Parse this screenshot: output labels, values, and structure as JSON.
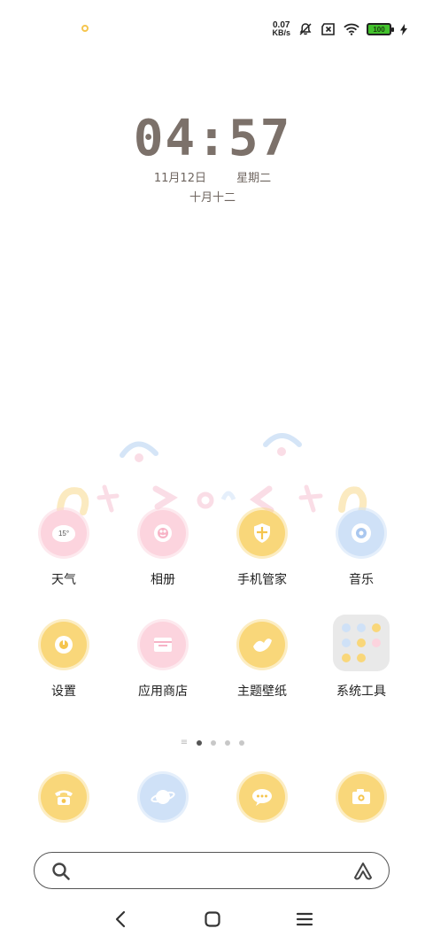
{
  "status_bar": {
    "net_speed_value": "0.07",
    "net_speed_unit": "KB/s",
    "battery_level": "100",
    "icons": [
      "notification-dot-icon",
      "bell-off-icon",
      "sim-off-icon",
      "wifi-icon",
      "battery-icon",
      "charging-icon"
    ]
  },
  "clock": {
    "time": "04:57",
    "date": "11月12日",
    "weekday": "星期二",
    "lunar": "十月十二"
  },
  "apps_row1": [
    {
      "label": "天气",
      "icon": "weather-icon",
      "weather_temp": "15°"
    },
    {
      "label": "相册",
      "icon": "gallery-icon"
    },
    {
      "label": "手机管家",
      "icon": "security-icon"
    },
    {
      "label": "音乐",
      "icon": "music-icon"
    }
  ],
  "apps_row2": [
    {
      "label": "设置",
      "icon": "settings-icon"
    },
    {
      "label": "应用商店",
      "icon": "app-store-icon"
    },
    {
      "label": "主题壁纸",
      "icon": "themes-icon"
    },
    {
      "label": "系统工具",
      "icon": "system-tools-folder-icon"
    }
  ],
  "page_indicator": {
    "pages": 4,
    "active_page": 1
  },
  "dock": [
    {
      "icon": "phone-icon"
    },
    {
      "icon": "browser-icon"
    },
    {
      "icon": "messages-icon"
    },
    {
      "icon": "camera-icon"
    }
  ],
  "search": {
    "placeholder": ""
  },
  "navigation": {
    "buttons": [
      "back-icon",
      "home-icon",
      "recents-icon"
    ]
  },
  "colors": {
    "clock": "#7c716a",
    "icon_yellow": "#f9d77a",
    "icon_pink": "#fcd4de",
    "icon_blue": "#cfe1f7",
    "battery_green": "#43c22d"
  }
}
